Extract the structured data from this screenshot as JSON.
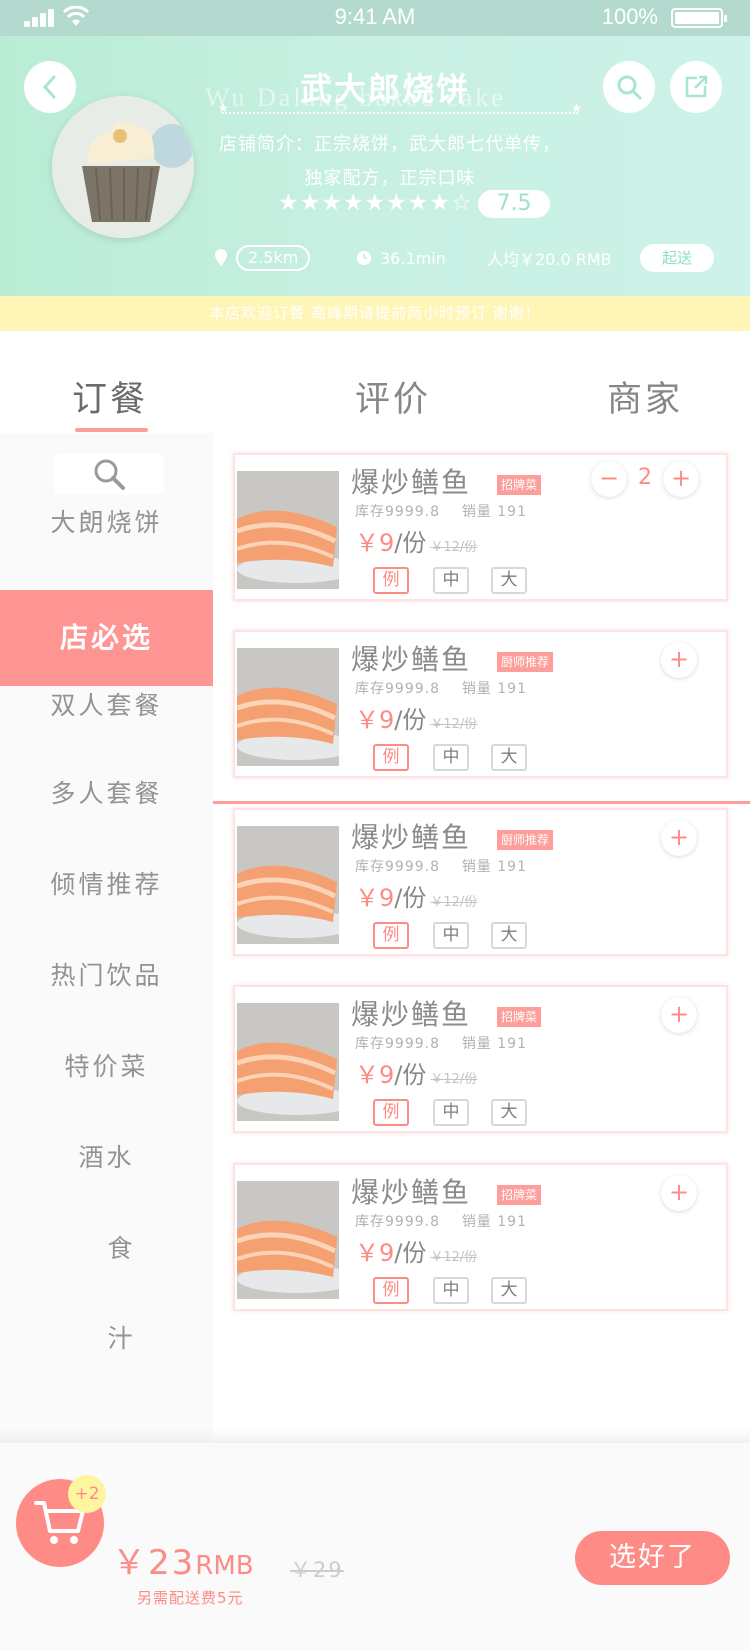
{
  "status_bar": {
    "time": "9:41 AM",
    "battery": "100%"
  },
  "store": {
    "name": "武大郎烧饼",
    "watermark": "Wu Dalang baked cake",
    "intro_line1": "店铺简介：正宗烧饼，武大郎七代单传，",
    "intro_line2": "独家配方，正宗口味",
    "stars": "★★★★★★★★☆",
    "rating": "7.5",
    "distance": "2.5km",
    "time": "36.1min",
    "avg_price": "人均￥20.0 RMB",
    "delivery_label": "起送",
    "notice": "本店欢迎订餐  高峰期请提前两小时预订 谢谢！"
  },
  "tabs": [
    {
      "label": "订餐",
      "active": true
    },
    {
      "label": "评价",
      "active": false
    },
    {
      "label": "商家",
      "active": false
    }
  ],
  "sidebar": {
    "items": [
      {
        "label": "大朗烧饼"
      },
      {
        "label": "店必选",
        "active": true
      },
      {
        "label": "双人套餐"
      },
      {
        "label": "多人套餐"
      },
      {
        "label": "倾情推荐"
      },
      {
        "label": "热门饮品"
      },
      {
        "label": "特价菜"
      },
      {
        "label": "酒水"
      },
      {
        "label": "食"
      },
      {
        "label": "汁"
      }
    ]
  },
  "products": [
    {
      "name": "爆炒鳝鱼",
      "tag": "招牌菜",
      "stock": "库存9999.8",
      "sales": "销量 191",
      "price": "￥9",
      "unit": "/份",
      "old_price": "￥12/份",
      "sizes": [
        "例",
        "中",
        "大"
      ],
      "selected_size": "例",
      "qty": "2",
      "minus": "−",
      "plus": "+"
    },
    {
      "name": "爆炒鳝鱼",
      "tag": "厨师推荐",
      "stock": "库存9999.8",
      "sales": "销量 191",
      "price": "￥9",
      "unit": "/份",
      "old_price": "￥12/份",
      "sizes": [
        "例",
        "中",
        "大"
      ],
      "selected_size": "例",
      "plus": "+"
    },
    {
      "name": "爆炒鳝鱼",
      "tag": "厨师推荐",
      "stock": "库存9999.8",
      "sales": "销量 191",
      "price": "￥9",
      "unit": "/份",
      "old_price": "￥12/份",
      "sizes": [
        "例",
        "中",
        "大"
      ],
      "selected_size": "例",
      "plus": "+"
    },
    {
      "name": "爆炒鳝鱼",
      "tag": "招牌菜",
      "stock": "库存9999.8",
      "sales": "销量 191",
      "price": "￥9",
      "unit": "/份",
      "old_price": "￥12/份",
      "sizes": [
        "例",
        "中",
        "大"
      ],
      "selected_size": "例",
      "plus": "+"
    },
    {
      "name": "爆炒鳝鱼",
      "tag": "招牌菜",
      "stock": "库存9999.8",
      "sales": "销量 191",
      "price": "￥9",
      "unit": "/份",
      "old_price": "￥12/份",
      "sizes": [
        "例",
        "中",
        "大"
      ],
      "selected_size": "例",
      "plus": "+"
    }
  ],
  "cart": {
    "badge": "+2",
    "total": "￥23",
    "total_unit": "RMB",
    "old_total": "￥29",
    "fee_note": "另需配送费5元",
    "checkout_label": "选好了"
  },
  "colors": {
    "accent": "#ff8b86",
    "header_bg": "#c8f0e2",
    "notice_bg": "#fff5b7"
  },
  "icons": [
    "back-icon",
    "search-icon",
    "share-icon",
    "location-icon",
    "clock-icon",
    "cart-icon"
  ]
}
